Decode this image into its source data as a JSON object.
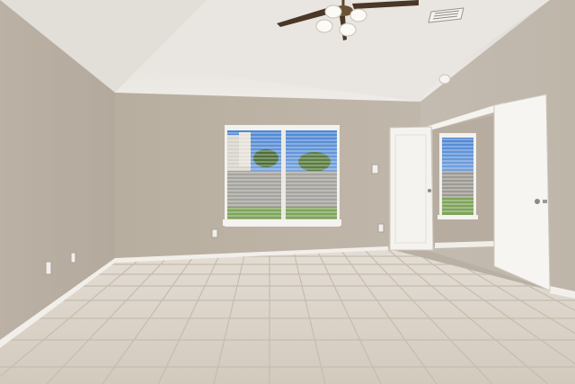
{
  "scene": {
    "subject": "empty-room",
    "palette": {
      "wall": "#bdb3a7",
      "wall_shadow": "#aca194",
      "ceiling": "#ece9e4",
      "floor": "#d9d1c6",
      "grout": "#c4baad",
      "trim": "#f4f2ef",
      "door": "#f3f1ee",
      "sky": "#6f9fd6",
      "lawn": "#7ea45a"
    },
    "objects": [
      {
        "id": "ceiling-fan",
        "icon": "fan-icon"
      },
      {
        "id": "hvac-vent",
        "icon": "vent-icon"
      },
      {
        "id": "smoke-detector",
        "icon": "circle-icon"
      },
      {
        "id": "main-window",
        "icon": "window-icon"
      },
      {
        "id": "closet-door-left",
        "icon": "door-icon"
      },
      {
        "id": "closet-door-right",
        "icon": "door-icon"
      },
      {
        "id": "closet-window",
        "icon": "window-icon"
      },
      {
        "id": "light-switch",
        "icon": "switch-icon"
      },
      {
        "id": "power-outlets",
        "icon": "outlet-icon"
      },
      {
        "id": "tile-floor",
        "icon": "tile-icon"
      }
    ]
  }
}
